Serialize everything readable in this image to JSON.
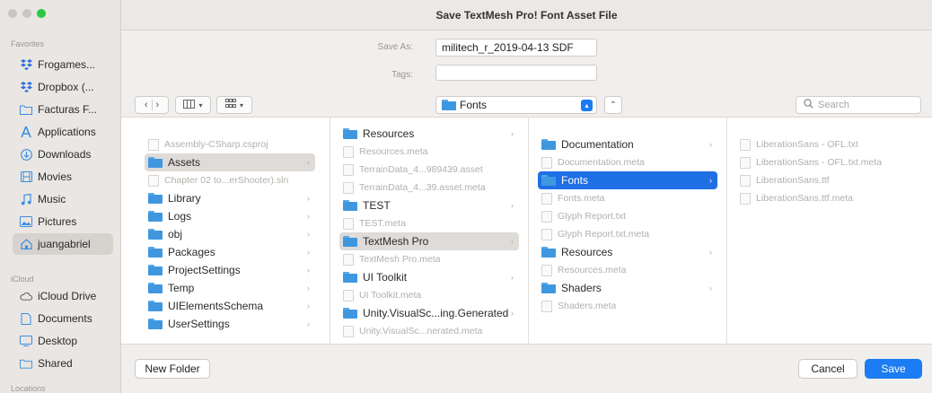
{
  "window": {
    "title": "Save TextMesh Pro! Font Asset File"
  },
  "sidebar": {
    "favorites_label": "Favorites",
    "favorites": [
      {
        "label": "Frogames...",
        "icon": "dropbox-icon"
      },
      {
        "label": "Dropbox (...",
        "icon": "dropbox-icon"
      },
      {
        "label": "Facturas F...",
        "icon": "folder-icon"
      },
      {
        "label": "Applications",
        "icon": "applications-icon"
      },
      {
        "label": "Downloads",
        "icon": "download-icon"
      },
      {
        "label": "Movies",
        "icon": "film-icon"
      },
      {
        "label": "Music",
        "icon": "music-icon"
      },
      {
        "label": "Pictures",
        "icon": "pictures-icon"
      },
      {
        "label": "juangabriel",
        "icon": "home-icon"
      }
    ],
    "icloud_label": "iCloud",
    "icloud": [
      {
        "label": "iCloud Drive",
        "icon": "cloud-icon"
      },
      {
        "label": "Documents",
        "icon": "document-icon"
      },
      {
        "label": "Desktop",
        "icon": "desktop-icon"
      },
      {
        "label": "Shared",
        "icon": "shared-folder-icon"
      }
    ],
    "locations_label": "Locations"
  },
  "form": {
    "save_as_label": "Save As:",
    "save_as_value": "militech_r_2019-04-13 SDF",
    "tags_label": "Tags:",
    "tags_value": ""
  },
  "toolbar": {
    "location": "Fonts",
    "search_placeholder": "Search"
  },
  "columns": [
    {
      "items": [
        {
          "label": "Assembly-CSharp.csproj",
          "kind": "file",
          "dim": true
        },
        {
          "label": "Assets",
          "kind": "folder",
          "selected": "gray",
          "chevron": true
        },
        {
          "label": "Chapter 02 to...erShooter).sln",
          "kind": "file",
          "dim": true
        },
        {
          "label": "Library",
          "kind": "folder",
          "chevron": true
        },
        {
          "label": "Logs",
          "kind": "folder",
          "chevron": true
        },
        {
          "label": "obj",
          "kind": "folder",
          "chevron": true
        },
        {
          "label": "Packages",
          "kind": "folder",
          "chevron": true
        },
        {
          "label": "ProjectSettings",
          "kind": "folder",
          "chevron": true
        },
        {
          "label": "Temp",
          "kind": "folder",
          "chevron": true
        },
        {
          "label": "UIElementsSchema",
          "kind": "folder",
          "chevron": true
        },
        {
          "label": "UserSettings",
          "kind": "folder",
          "chevron": true
        }
      ]
    },
    {
      "items": [
        {
          "label": "Resources",
          "kind": "folder",
          "chevron": true
        },
        {
          "label": "Resources.meta",
          "kind": "file",
          "dim": true
        },
        {
          "label": "TerrainData_4...989439.asset",
          "kind": "file",
          "dim": true
        },
        {
          "label": "TerrainData_4...39.asset.meta",
          "kind": "file",
          "dim": true
        },
        {
          "label": "TEST",
          "kind": "folder",
          "chevron": true
        },
        {
          "label": "TEST.meta",
          "kind": "file",
          "dim": true
        },
        {
          "label": "TextMesh Pro",
          "kind": "folder",
          "selected": "gray",
          "chevron": true
        },
        {
          "label": "TextMesh Pro.meta",
          "kind": "file",
          "dim": true
        },
        {
          "label": "UI Toolkit",
          "kind": "folder",
          "chevron": true
        },
        {
          "label": "UI Toolkit.meta",
          "kind": "file",
          "dim": true
        },
        {
          "label": "Unity.VisualSc...ing.Generated",
          "kind": "folder",
          "chevron": true
        },
        {
          "label": "Unity.VisualSc...nerated.meta",
          "kind": "file",
          "dim": true
        }
      ]
    },
    {
      "items": [
        {
          "label": "Documentation",
          "kind": "folder",
          "chevron": true
        },
        {
          "label": "Documentation.meta",
          "kind": "file",
          "dim": true
        },
        {
          "label": "Fonts",
          "kind": "folder",
          "selected": "blue",
          "chevron": true
        },
        {
          "label": "Fonts.meta",
          "kind": "file",
          "dim": true
        },
        {
          "label": "Glyph Report.txt",
          "kind": "file",
          "dim": true
        },
        {
          "label": "Glyph Report.txt.meta",
          "kind": "file",
          "dim": true
        },
        {
          "label": "Resources",
          "kind": "folder",
          "chevron": true
        },
        {
          "label": "Resources.meta",
          "kind": "file",
          "dim": true
        },
        {
          "label": "Shaders",
          "kind": "folder",
          "chevron": true
        },
        {
          "label": "Shaders.meta",
          "kind": "file",
          "dim": true
        }
      ]
    },
    {
      "items": [
        {
          "label": "LiberationSans - OFL.txt",
          "kind": "file",
          "dim": true
        },
        {
          "label": "LiberationSans - OFL.txt.meta",
          "kind": "file",
          "dim": true
        },
        {
          "label": "LiberationSans.ttf",
          "kind": "file",
          "dim": true
        },
        {
          "label": "LiberationSans.ttf.meta",
          "kind": "file",
          "dim": true
        }
      ]
    }
  ],
  "buttons": {
    "new_folder": "New Folder",
    "cancel": "Cancel",
    "save": "Save"
  },
  "colors": {
    "accent": "#1b7cf3",
    "folder": "#3f97e0",
    "selection_gray": "#dedbd8"
  }
}
